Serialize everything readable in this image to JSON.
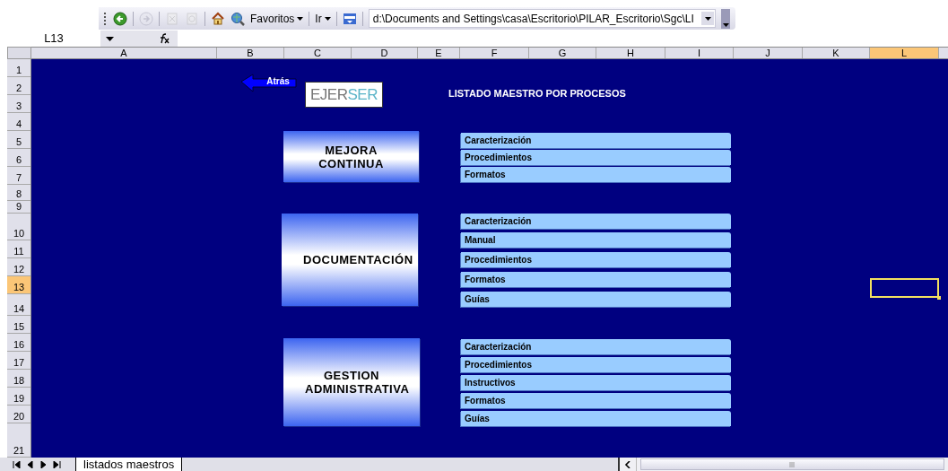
{
  "toolbar": {
    "icons": [
      {
        "kind": "back",
        "disabled": false
      },
      {
        "kind": "forward",
        "disabled": true
      },
      {
        "kind": "stop",
        "disabled": true
      },
      {
        "kind": "refresh",
        "disabled": true
      },
      {
        "kind": "home",
        "disabled": false
      },
      {
        "kind": "search",
        "disabled": false
      }
    ],
    "menus": [
      "Favoritos",
      "Ir"
    ],
    "address": "d:\\Documents and Settings\\casa\\Escritorio\\PILAR_Escritorio\\Sgc\\LI"
  },
  "name_box": "L13",
  "columns": [
    {
      "label": "A",
      "selected": false
    },
    {
      "label": "B",
      "selected": false
    },
    {
      "label": "C",
      "selected": false
    },
    {
      "label": "D",
      "selected": false
    },
    {
      "label": "E",
      "selected": false
    },
    {
      "label": "F",
      "selected": false
    },
    {
      "label": "G",
      "selected": false
    },
    {
      "label": "H",
      "selected": false
    },
    {
      "label": "I",
      "selected": false
    },
    {
      "label": "J",
      "selected": false
    },
    {
      "label": "K",
      "selected": false
    },
    {
      "label": "L",
      "selected": true
    }
  ],
  "rows": [
    {
      "label": "1",
      "selected": false
    },
    {
      "label": "2",
      "selected": false
    },
    {
      "label": "3",
      "selected": false
    },
    {
      "label": "4",
      "selected": false
    },
    {
      "label": "5",
      "selected": false
    },
    {
      "label": "6",
      "selected": false
    },
    {
      "label": "7",
      "selected": false
    },
    {
      "label": "8",
      "selected": false
    },
    {
      "label": "9",
      "selected": false
    },
    {
      "label": "10",
      "selected": false
    },
    {
      "label": "11",
      "selected": false
    },
    {
      "label": "12",
      "selected": false
    },
    {
      "label": "13",
      "selected": true
    },
    {
      "label": "14",
      "selected": false
    },
    {
      "label": "15",
      "selected": false
    },
    {
      "label": "16",
      "selected": false
    },
    {
      "label": "17",
      "selected": false
    },
    {
      "label": "18",
      "selected": false
    },
    {
      "label": "19",
      "selected": false
    },
    {
      "label": "20",
      "selected": false
    },
    {
      "label": "21",
      "selected": false
    }
  ],
  "sheet": {
    "back_button": "Atrás",
    "logo": {
      "part_1": "EJER",
      "part_2": "SER"
    },
    "title": "LISTADO MAESTRO POR PROCESOS",
    "groups": [
      {
        "label": "MEJORA CONTINUA",
        "items": [
          "Caracterización",
          "Procedimientos",
          "Formatos"
        ]
      },
      {
        "label": "DOCUMENTACIÓN",
        "items": [
          "Caracterización",
          "Manual",
          "Procedimientos",
          "Formatos",
          "Guías"
        ]
      },
      {
        "label": "GESTION ADMINISTRATIVA",
        "items": [
          "Caracterización",
          "Procedimientos",
          "Instructivos",
          "Formatos",
          "Guías"
        ]
      }
    ]
  },
  "sheet_tabs": [
    {
      "label": "listados maestros",
      "selected": true
    }
  ]
}
